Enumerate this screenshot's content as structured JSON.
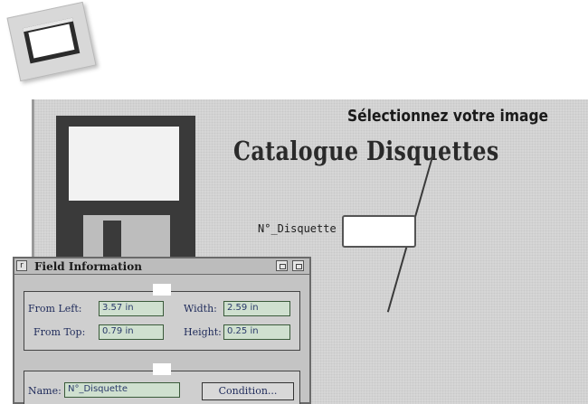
{
  "annotation": "Sélectionnez votre image",
  "catalog": {
    "title": "Catalogue Disquettes",
    "field_label": "N°_Disquette",
    "field_value": ""
  },
  "field_info": {
    "title": "Field Information",
    "close_glyph": "r",
    "position_group": {
      "from_left_label": "From Left:",
      "from_left_value": "3.57 in",
      "width_label": "Width:",
      "width_value": "2.59 in",
      "from_top_label": "From Top:",
      "from_top_value": "0.79 in",
      "height_label": "Height:",
      "height_value": "0.25 in"
    },
    "settings_group": {
      "name_label": "Name:",
      "name_value": "N°_Disquette",
      "condition_button": "Condition..."
    }
  },
  "icons": [
    "image-frame-icon",
    "floppy-disk-icon",
    "close-icon",
    "window-zoom-icon",
    "window-shrink-icon"
  ]
}
